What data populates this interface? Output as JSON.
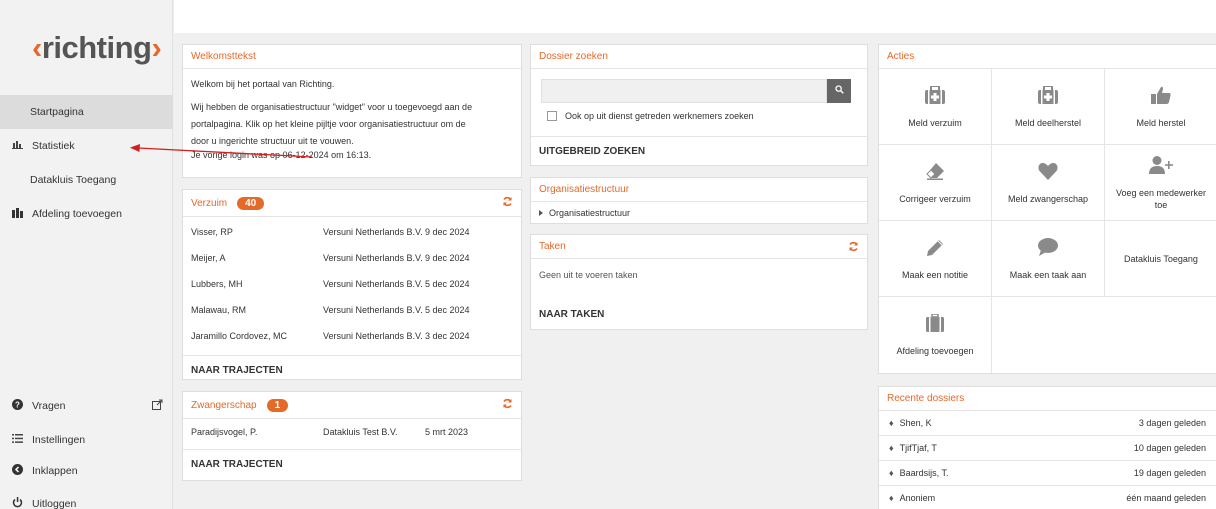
{
  "brand": {
    "logo_text": "richting",
    "logo_left": "‹",
    "logo_right": "›",
    "accent": "#e46a2a"
  },
  "sidebar": {
    "items": [
      {
        "label": "Startpagina",
        "icon": ""
      },
      {
        "label": "Statistiek",
        "icon": "bar-chart-icon"
      },
      {
        "label": "Datakluis Toegang",
        "icon": ""
      },
      {
        "label": "Afdeling toevoegen",
        "icon": "building-icon"
      }
    ],
    "bottom_items": [
      {
        "label": "Vragen",
        "icon": "question-circle-icon"
      },
      {
        "label": "Instellingen",
        "icon": "list-icon"
      },
      {
        "label": "Inklappen",
        "icon": "chevron-left-circle-icon"
      },
      {
        "label": "Uitloggen",
        "icon": "power-icon"
      }
    ]
  },
  "welcome": {
    "title": "Welkomsttekst",
    "line1": "Welkom bij het portaal van Richting.",
    "line2": "Wij hebben de organisatiestructuur \"widget\" voor u toegevoegd aan de",
    "line3": "portalpagina. Klik op het kleine pijltje voor organisatiestructuur om de",
    "line4": "door u ingerichte structuur uit te vouwen.",
    "line5": "Je vorige login was op 06-12-2024 om 16:13."
  },
  "verzuim": {
    "title": "Verzuim",
    "count": "40",
    "rows": [
      {
        "name": "Visser, RP",
        "org": "Versuni Netherlands B.V.",
        "date": "9 dec 2024"
      },
      {
        "name": "Meijer, A",
        "org": "Versuni Netherlands B.V.",
        "date": "9 dec 2024"
      },
      {
        "name": "Lubbers, MH",
        "org": "Versuni Netherlands B.V.",
        "date": "5 dec 2024"
      },
      {
        "name": "Malawau, RM",
        "org": "Versuni Netherlands B.V.",
        "date": "5 dec 2024"
      },
      {
        "name": "Jaramillo Cordovez, MC",
        "org": "Versuni Netherlands B.V.",
        "date": "3 dec 2024"
      }
    ],
    "link": "NAAR TRAJECTEN"
  },
  "zwangerschap": {
    "title": "Zwangerschap",
    "count": "1",
    "rows": [
      {
        "name": "Paradijsvogel, P.",
        "org": "Datakluis Test B.V.",
        "date": "5 mrt 2023"
      }
    ],
    "link": "NAAR TRAJECTEN"
  },
  "dossier": {
    "title": "Dossier zoeken",
    "search_placeholder": "",
    "checkbox_label": "Ook op uit dienst getreden werknemers zoeken",
    "link": "UITGEBREID ZOEKEN"
  },
  "org": {
    "title": "Organisatiestructuur",
    "item": "Organisatiestructuur"
  },
  "taken": {
    "title": "Taken",
    "empty": "Geen uit te voeren taken",
    "link": "NAAR TAKEN"
  },
  "acties": {
    "title": "Acties",
    "items": [
      {
        "label": "Meld verzuim",
        "icon": "medkit-icon"
      },
      {
        "label": "Meld deelherstel",
        "icon": "medkit-icon"
      },
      {
        "label": "Meld herstel",
        "icon": "thumbs-up-icon"
      },
      {
        "label": "Corrigeer verzuim",
        "icon": "eraser-icon"
      },
      {
        "label": "Meld zwangerschap",
        "icon": "heart-icon"
      },
      {
        "label": "Voeg een medewerker toe",
        "icon": "user-plus-icon"
      },
      {
        "label": "Maak een notitie",
        "icon": "pencil-icon"
      },
      {
        "label": "Maak een taak aan",
        "icon": "comment-icon"
      },
      {
        "label": "Datakluis Toegang",
        "icon": ""
      },
      {
        "label": "Afdeling toevoegen",
        "icon": "building-icon"
      }
    ]
  },
  "recent": {
    "title": "Recente dossiers",
    "rows": [
      {
        "name": "Shen, K",
        "age": "3 dagen geleden"
      },
      {
        "name": "TjifTjaf, T",
        "age": "10 dagen geleden"
      },
      {
        "name": "Baardsijs, T.",
        "age": "19 dagen geleden"
      },
      {
        "name": "Anoniem",
        "age": "één maand geleden"
      }
    ]
  }
}
